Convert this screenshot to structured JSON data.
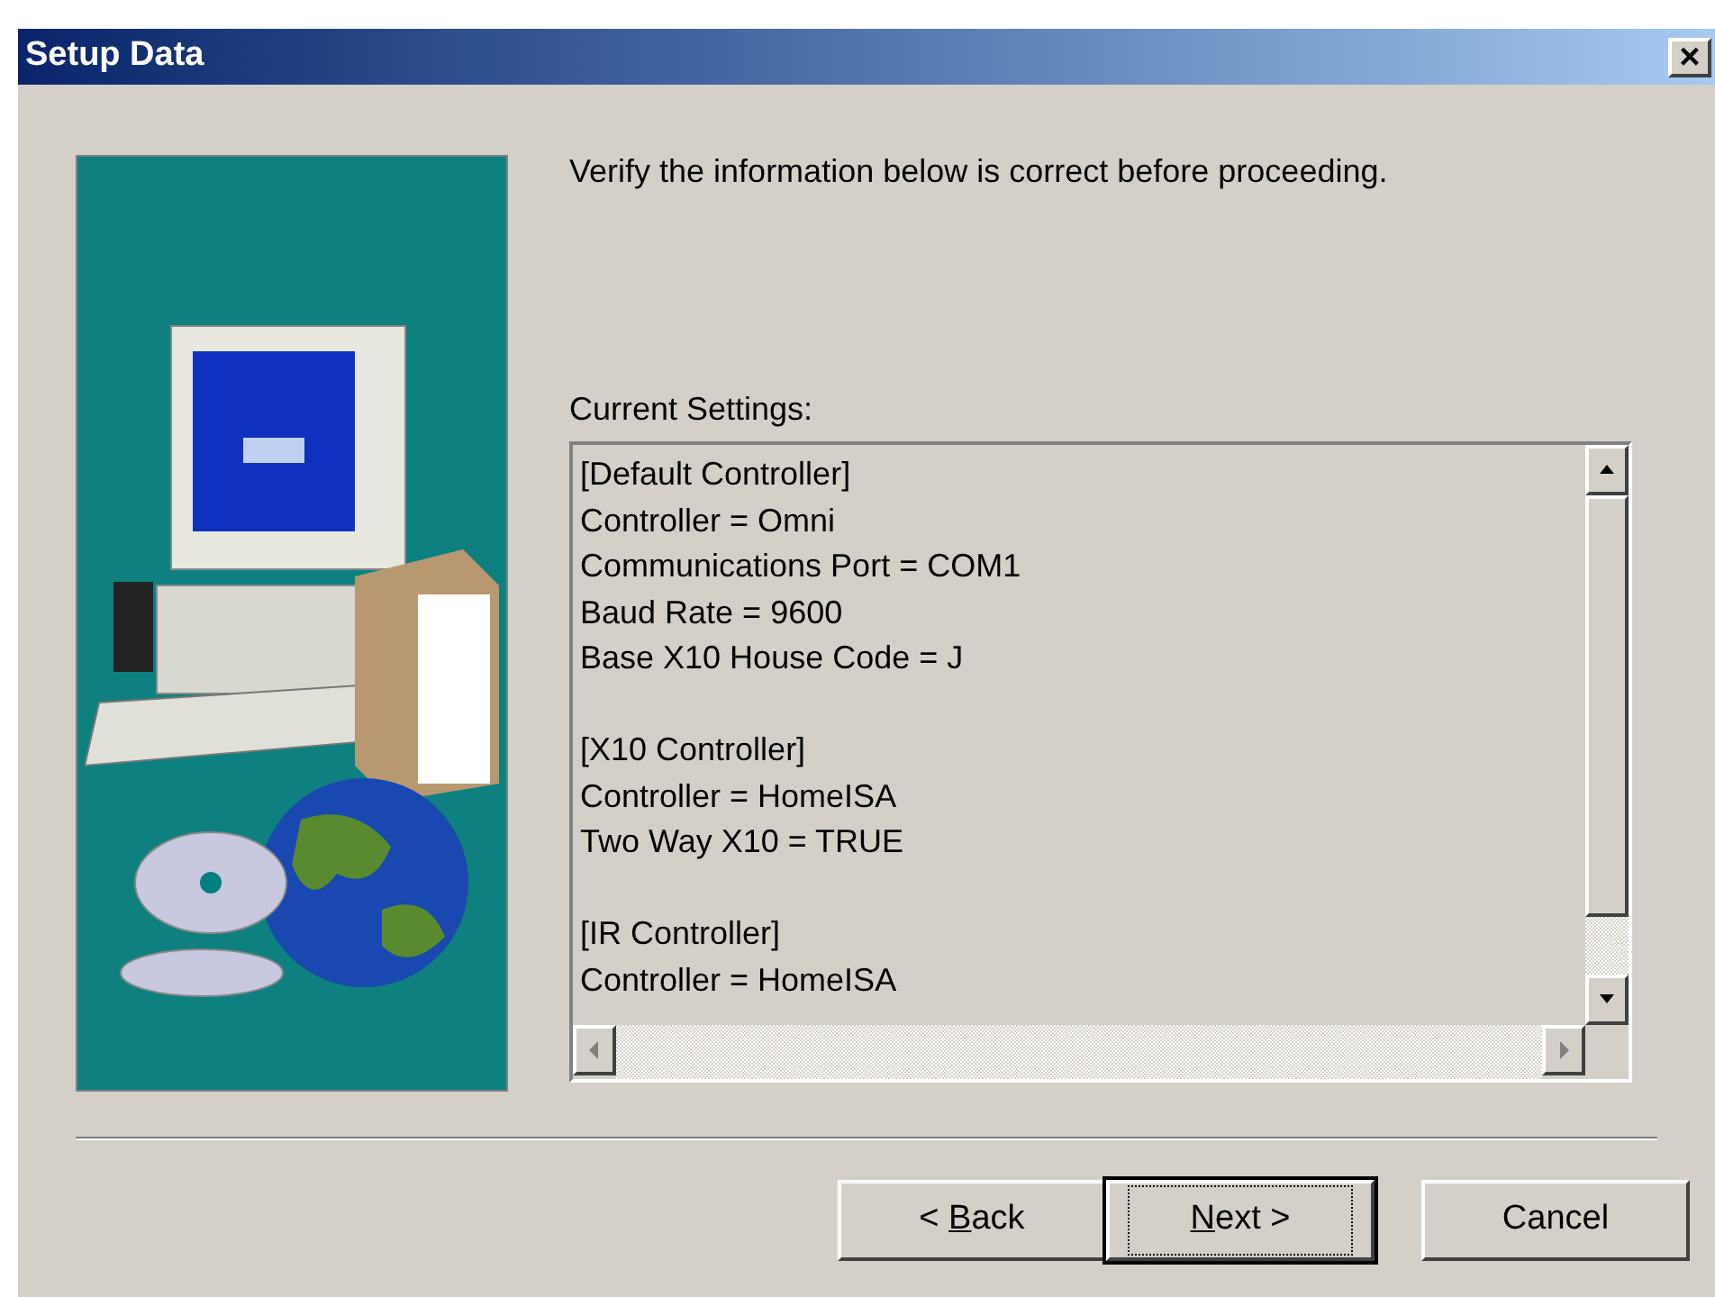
{
  "window": {
    "title": "Setup Data",
    "close": "×"
  },
  "intro": "Verify the information below is correct before proceeding.",
  "settings_label": "Current Settings:",
  "settings_groups": [
    {
      "lines": [
        "[Default Controller]",
        "Controller = Omni",
        "Communications Port = COM1",
        "Baud Rate = 9600",
        "Base X10 House Code = J"
      ]
    },
    {
      "lines": [
        "[X10 Controller]",
        "Controller = HomeISA",
        "Two Way X10 = TRUE"
      ]
    },
    {
      "lines": [
        "[IR Controller]",
        "Controller = HomeISA"
      ]
    }
  ],
  "buttons": [
    {
      "before": "< ",
      "access_key": "B",
      "after": "ack",
      "default": false
    },
    {
      "access_key": "N",
      "after": "ext >",
      "default": true
    },
    {
      "before": "Cancel",
      "default": false
    }
  ]
}
